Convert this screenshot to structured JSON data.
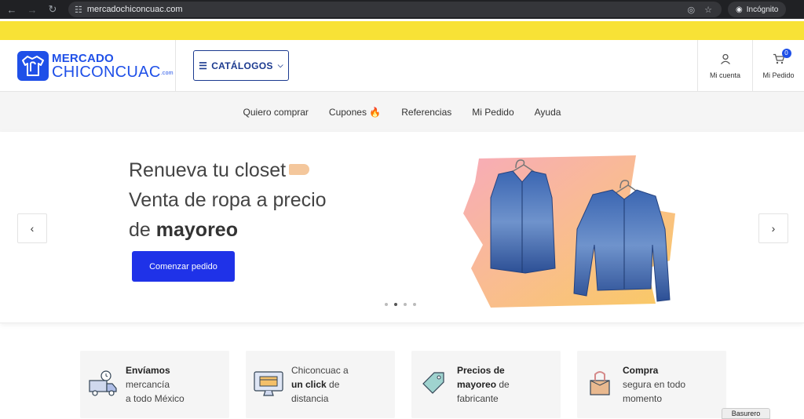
{
  "browser": {
    "url": "mercadochiconcuac.com",
    "incognito_label": "Incógnito"
  },
  "logo": {
    "line1": "MERCADO",
    "line2": "CHICONCUAC",
    "suffix": ".com"
  },
  "header": {
    "catalog_label": "CATÁLOGOS",
    "account_label": "Mi cuenta",
    "order_label": "Mi Pedido",
    "cart_count": "0"
  },
  "menu": {
    "items": [
      {
        "label": "Quiero comprar"
      },
      {
        "label": "Cupones 🔥"
      },
      {
        "label": "Referencias"
      },
      {
        "label": "Mi Pedido"
      },
      {
        "label": "Ayuda"
      }
    ]
  },
  "hero": {
    "line1": "Renueva tu closet",
    "line2": "Venta de ropa a precio",
    "line3_prefix": "de ",
    "line3_bold": "mayoreo",
    "cta": "Comenzar pedido",
    "slides": 4,
    "active_slide": 2
  },
  "features": [
    {
      "icon": "delivery-truck-icon",
      "bold": "Envíamos",
      "rest1": "mercancía",
      "rest2": "a todo México"
    },
    {
      "icon": "online-shop-icon",
      "pre": "Chiconcuac a",
      "bold": "un click",
      "post": " de",
      "rest2": "distancia"
    },
    {
      "icon": "price-tag-icon",
      "bold": "Precios de",
      "bold2": "mayoreo",
      "post": " de",
      "rest2": "fabricante"
    },
    {
      "icon": "secure-package-icon",
      "bold": "Compra",
      "rest1": "segura en todo",
      "rest2": "momento"
    }
  ],
  "basurero_label": "Basurero",
  "colors": {
    "brand_blue": "#1f50e8",
    "promo_yellow": "#f8e236",
    "cta_blue": "#1f32e8"
  }
}
